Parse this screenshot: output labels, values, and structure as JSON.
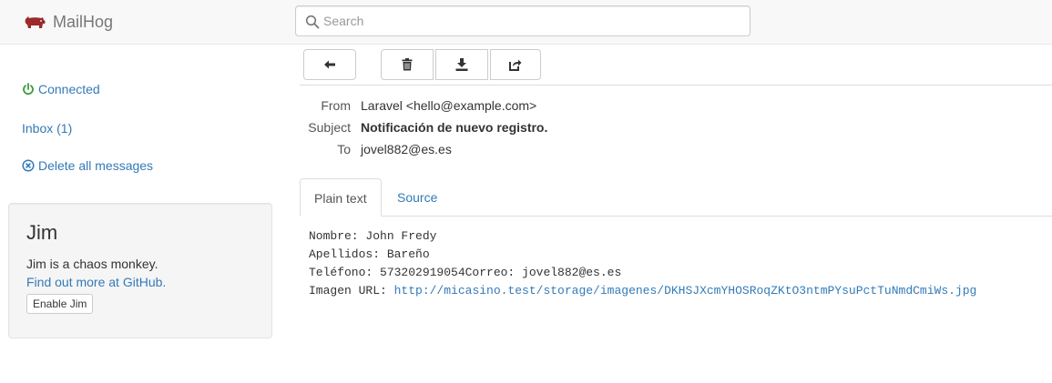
{
  "navbar": {
    "brand": "MailHog",
    "search_placeholder": "Search",
    "icons": {
      "brand": "pig-icon",
      "search": "search-icon"
    }
  },
  "sidebar": {
    "connected": "Connected",
    "inbox": "Inbox (1)",
    "delete_all": "Delete all messages",
    "jim": {
      "title": "Jim",
      "text": "Jim is a chaos monkey.",
      "link": "Find out more at GitHub.",
      "button": "Enable Jim"
    }
  },
  "toolbar": {
    "icons": [
      "arrow-left-icon",
      "trash-icon",
      "download-icon",
      "share-icon"
    ]
  },
  "message": {
    "headers": {
      "from_label": "From",
      "from_value": "Laravel <hello@example.com>",
      "subject_label": "Subject",
      "subject_value": "Notificación de nuevo registro.",
      "to_label": "To",
      "to_value": "jovel882@es.es"
    },
    "tabs": {
      "plain": "Plain text",
      "source": "Source"
    },
    "body": {
      "line1": "Nombre: John Fredy",
      "line2": "Apellidos: Bareño",
      "line3": "Teléfono: 573202919054Correo: jovel882@es.es",
      "line4_label": "Imagen URL: ",
      "line4_url": "http://micasino.test/storage/imagenes/DKHSJXcmYHOSRoqZKtO3ntmPYsuPctTuNmdCmiWs.jpg"
    }
  },
  "colors": {
    "link": "#337ab7",
    "brand_icon": "#9b2a2a",
    "connected_icon": "#3c9a3c",
    "navbar_bg": "#f8f8f8"
  }
}
